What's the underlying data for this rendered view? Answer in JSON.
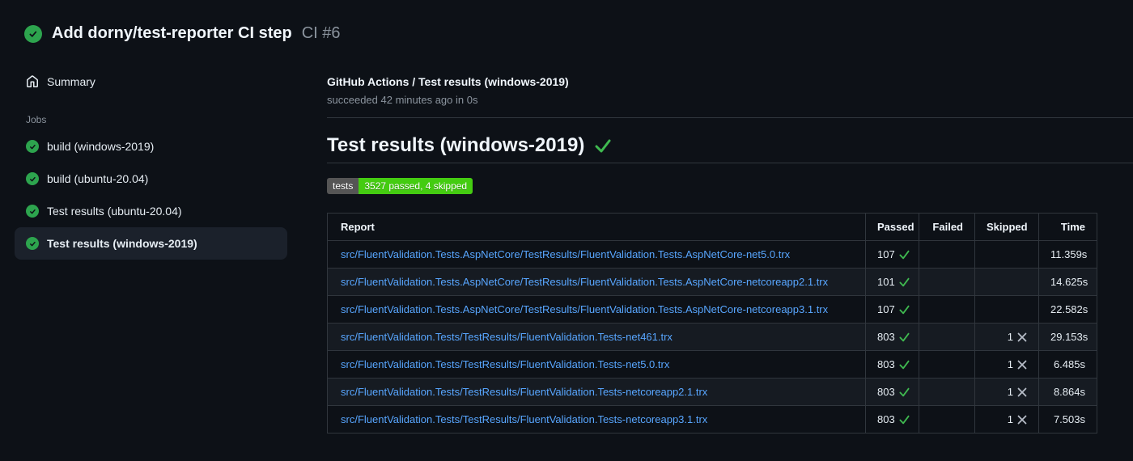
{
  "header": {
    "title": "Add dorny/test-reporter CI step",
    "run_ref": "CI #6",
    "status": "success"
  },
  "sidebar": {
    "summary_label": "Summary",
    "jobs_label": "Jobs",
    "jobs": [
      {
        "label": "build (windows-2019)",
        "status": "success",
        "selected": false
      },
      {
        "label": "build (ubuntu-20.04)",
        "status": "success",
        "selected": false
      },
      {
        "label": "Test results (ubuntu-20.04)",
        "status": "success",
        "selected": false
      },
      {
        "label": "Test results (windows-2019)",
        "status": "success",
        "selected": true
      }
    ]
  },
  "main": {
    "check_title": "GitHub Actions / Test results (windows-2019)",
    "check_status": "succeeded 42 minutes ago in 0s",
    "section_title": "Test results (windows-2019)",
    "badge": {
      "label": "tests",
      "value": "3527 passed, 4 skipped",
      "label_bg": "#555555",
      "value_bg": "#44cc11"
    },
    "table": {
      "columns": [
        "Report",
        "Passed",
        "Failed",
        "Skipped",
        "Time"
      ],
      "rows": [
        {
          "report": "src/FluentValidation.Tests.AspNetCore/TestResults/FluentValidation.Tests.AspNetCore-net5.0.trx",
          "passed": "107",
          "failed": "",
          "skipped": "",
          "time": "11.359s"
        },
        {
          "report": "src/FluentValidation.Tests.AspNetCore/TestResults/FluentValidation.Tests.AspNetCore-netcoreapp2.1.trx",
          "passed": "101",
          "failed": "",
          "skipped": "",
          "time": "14.625s"
        },
        {
          "report": "src/FluentValidation.Tests.AspNetCore/TestResults/FluentValidation.Tests.AspNetCore-netcoreapp3.1.trx",
          "passed": "107",
          "failed": "",
          "skipped": "",
          "time": "22.582s"
        },
        {
          "report": "src/FluentValidation.Tests/TestResults/FluentValidation.Tests-net461.trx",
          "passed": "803",
          "failed": "",
          "skipped": "1",
          "time": "29.153s"
        },
        {
          "report": "src/FluentValidation.Tests/TestResults/FluentValidation.Tests-net5.0.trx",
          "passed": "803",
          "failed": "",
          "skipped": "1",
          "time": "6.485s"
        },
        {
          "report": "src/FluentValidation.Tests/TestResults/FluentValidation.Tests-netcoreapp2.1.trx",
          "passed": "803",
          "failed": "",
          "skipped": "1",
          "time": "8.864s"
        },
        {
          "report": "src/FluentValidation.Tests/TestResults/FluentValidation.Tests-netcoreapp3.1.trx",
          "passed": "803",
          "failed": "",
          "skipped": "1",
          "time": "7.503s"
        }
      ]
    }
  },
  "colors": {
    "background": "#0d1117",
    "text": "#e6edf3",
    "muted": "#8b949e",
    "border": "#30363d",
    "row_alt": "#161b22",
    "selected_item_bg": "#1b212b",
    "success_green": "#2da44e",
    "check_green": "#3fb950",
    "link_blue": "#58a6ff",
    "skip_x_gray": "#b7bdc8",
    "badge_green": "#44cc11",
    "badge_gray": "#555555"
  },
  "icons": {
    "header_status": "check-circle-icon",
    "summary": "home-icon",
    "job_status": "check-circle-icon",
    "passed": "check-icon",
    "skipped": "x-icon"
  }
}
